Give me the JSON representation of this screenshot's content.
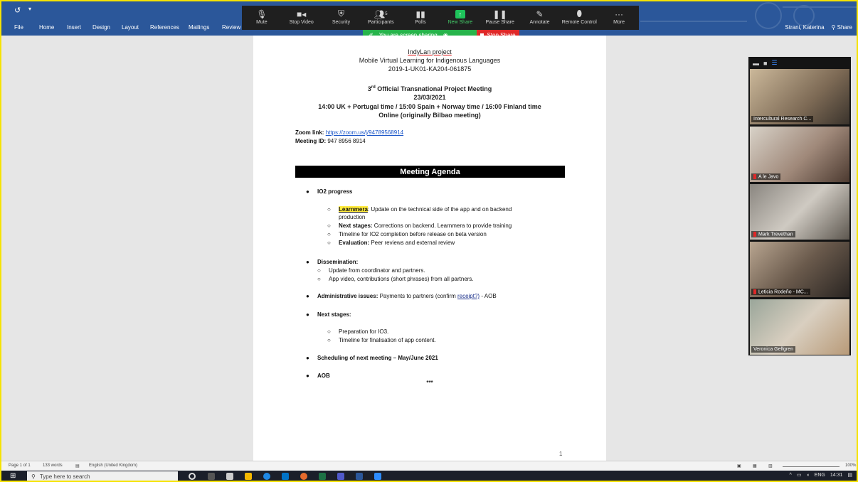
{
  "ribbon": {
    "qat_icon": "↺",
    "tabs": [
      "File",
      "Home",
      "Insert",
      "Design",
      "Layout",
      "References",
      "Mailings",
      "Review"
    ],
    "user": "Strani, Katerina",
    "share": "Share"
  },
  "zoom": {
    "buttons": [
      {
        "label": "Mute",
        "icon": "mic-icon"
      },
      {
        "label": "Stop Video",
        "icon": "camera-icon"
      },
      {
        "label": "Security",
        "icon": "shield-icon"
      },
      {
        "label": "Participants",
        "icon": "people-icon",
        "count": "5"
      },
      {
        "label": "Polls",
        "icon": "chart-icon"
      },
      {
        "label": "New Share",
        "icon": "share-up-icon"
      },
      {
        "label": "Pause Share",
        "icon": "pause-icon"
      },
      {
        "label": "Annotate",
        "icon": "pen-icon"
      },
      {
        "label": "Remote Control",
        "icon": "mouse-icon"
      },
      {
        "label": "More",
        "icon": "more-icon"
      }
    ],
    "sharing_text": "You are screen sharing",
    "stop_share": "Stop Share",
    "accent_green": "#27b44b",
    "stop_red": "#e02828"
  },
  "doc": {
    "line1": "IndyLan project",
    "line2": "Mobile Virtual Learning for Indigenous Languages",
    "line3": "2019-1-UK01-KA204-061875",
    "m_num": "3",
    "m_sup": "rd",
    "m_rest": " Official Transnational Project Meeting",
    "m_date": "23/03/2021",
    "m_time": "14:00 UK + Portugal time / 15:00 Spain + Norway time / 16:00 Finland time",
    "m_online": "Online (originally Bilbao meeting)",
    "zoom_label": "Zoom link:",
    "zoom_url": "https://zoom.us/j/94789568914",
    "mid_label": "Meeting ID:",
    "mid_value": " 947 8956 8914",
    "agenda_title": "Meeting Agenda",
    "io2": "IO2 progress",
    "sub1_hl": "Learnmera",
    "sub1_rest": ": Update on the technical side of the app and on backend",
    "sub1_cont": "production",
    "sub2_b": "Next stages:",
    "sub2_rest": " Corrections on backend. Learnmera to provide training",
    "sub3": "Timeline for IO2 completion before release on beta version",
    "sub4_b": "Evaluation:",
    "sub4_rest": " Peer reviews and external review",
    "diss": "Dissemination:",
    "diss1": "Update from coordinator and partners.",
    "diss2": "App video, contributions (short phrases) from all partners.",
    "admin_b": "Administrative issues:",
    "admin_rest": " Payments to partners (confirm ",
    "admin_link": "receipt?)",
    "admin_tail": " - AOB",
    "next": "Next stages:",
    "next1": "Preparation for IO3.",
    "next2": "Timeline for finalisation of app content.",
    "sched": "Scheduling of next meeting – May/June 2021",
    "aob": "AOB",
    "stars": "***",
    "page_num": "1"
  },
  "gallery": {
    "participants": [
      "Intercultural Research C...",
      "A le Javo",
      "Mark Trevethan",
      "Leticia Rodeño - MC...",
      "Veronica Gelfgren"
    ]
  },
  "status": {
    "page": "Page 1 of 1",
    "words": "133 words",
    "lang": "English (United Kingdom)",
    "zoom_pct": "100%"
  },
  "taskbar": {
    "search": "Type here to search",
    "lang": "ENG",
    "time": "14:31"
  }
}
